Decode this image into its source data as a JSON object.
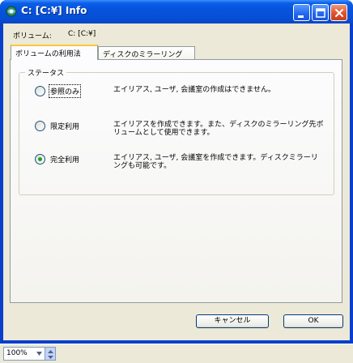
{
  "window": {
    "title": "C: [C:¥] Info",
    "colors": {
      "titlebar": "#0550d6",
      "client": "#ece9d8",
      "tab_highlight": "#ffc73c",
      "radio_dot": "#21a121"
    }
  },
  "volume": {
    "label": "ボリューム:",
    "value": "C: [C:¥]"
  },
  "tabs": [
    {
      "label": "ボリュームの利用法",
      "active": true
    },
    {
      "label": "ディスクのミラーリング",
      "active": false
    }
  ],
  "status_group": {
    "title": "ステータス",
    "options": [
      {
        "label": "参照のみ",
        "description": "エイリアス, ユーザ, 会議室の作成はできません。",
        "selected": false
      },
      {
        "label": "限定利用",
        "description": "エイリアスを作成できます。また、ディスクのミラーリング先ボリュームとして使用できます。",
        "selected": false
      },
      {
        "label": "完全利用",
        "description": "エイリアス, ユーザ, 会議室を作成できます。ディスクミラーリングも可能です。",
        "selected": true
      }
    ]
  },
  "buttons": {
    "cancel": "キャンセル",
    "ok": "OK"
  },
  "statusbar": {
    "zoom": "100%"
  },
  "icons": {
    "app": "app-icon",
    "minimize": "minimize-icon",
    "maximize": "maximize-icon",
    "close": "close-icon"
  }
}
